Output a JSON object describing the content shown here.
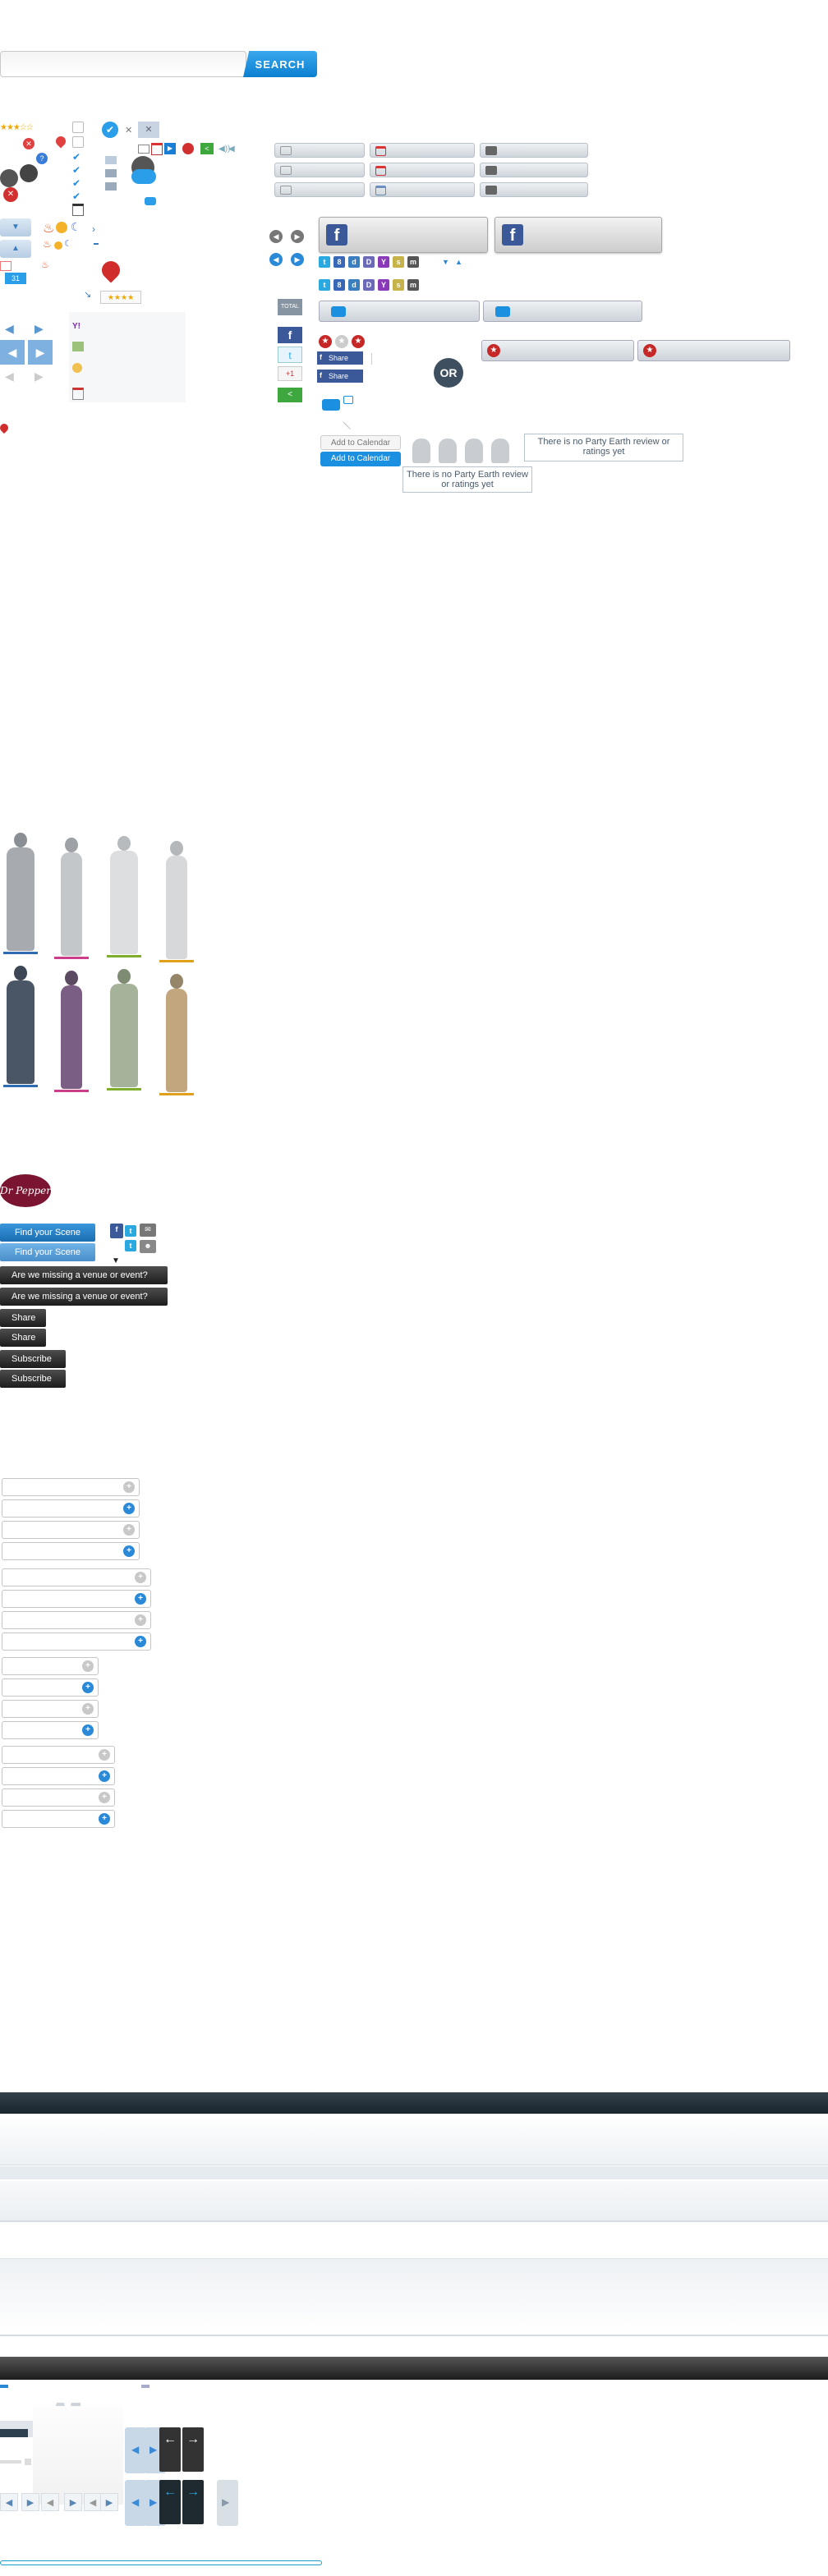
{
  "search": {
    "placeholder": "",
    "button_label": "SEARCH"
  },
  "colors": {
    "accent_blue": "#0b7fd0",
    "facebook_blue": "#3b5998",
    "dark_band": "#1f2b33",
    "red_badge": "#c62828",
    "underline_blue": "#2f6bb0",
    "underline_pink": "#cc3d8a",
    "underline_green": "#7fae2d",
    "underline_orange": "#e0a01c"
  },
  "social": {
    "total_label": "TOTAL",
    "share_label": "Share",
    "google_plus_label": "+1",
    "or_label": "OR",
    "add_to_calendar_1": "Add to Calendar",
    "add_to_calendar_2": "Add to Calendar",
    "no_review_1": "There is no Party Earth review or ratings yet",
    "no_review_2": "There is no Party Earth review or ratings yet"
  },
  "brand": {
    "logo_text": "Dr Pepper"
  },
  "actions": {
    "find_scene": "Find your Scene",
    "find_scene_hover": "Find your Scene",
    "missing_1": "Are we missing a venue or event?",
    "missing_2": "Are we missing a venue or event?",
    "share_1": "Share",
    "share_2": "Share",
    "subscribe_1": "Subscribe",
    "subscribe_2": "Subscribe"
  },
  "icons": [
    "star-rating-icon",
    "close-icon",
    "location-pin-icon",
    "checkbox-icon",
    "check-circle-icon",
    "chevron-right-icon",
    "chevron-left-icon",
    "fire-icon",
    "moon-icon",
    "share-icon",
    "email-icon",
    "calendar-icon",
    "print-icon",
    "facebook-icon",
    "twitter-icon",
    "google-plus-icon",
    "comment-icon",
    "user-silhouette-icon",
    "arrow-left-icon",
    "arrow-right-icon"
  ]
}
